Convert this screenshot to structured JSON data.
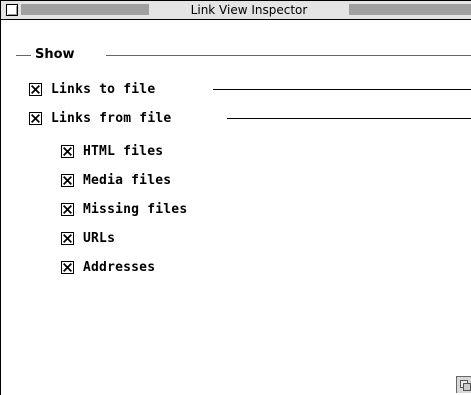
{
  "window": {
    "title": "Link View Inspector"
  },
  "group": {
    "title": "Show"
  },
  "options": [
    {
      "label": "Links to file",
      "checked": true
    },
    {
      "label": "Links from file",
      "checked": true
    },
    {
      "label": "HTML files",
      "checked": true
    },
    {
      "label": "Media files",
      "checked": true
    },
    {
      "label": "Missing files",
      "checked": true
    },
    {
      "label": "URLs",
      "checked": true
    },
    {
      "label": "Addresses",
      "checked": true
    }
  ]
}
